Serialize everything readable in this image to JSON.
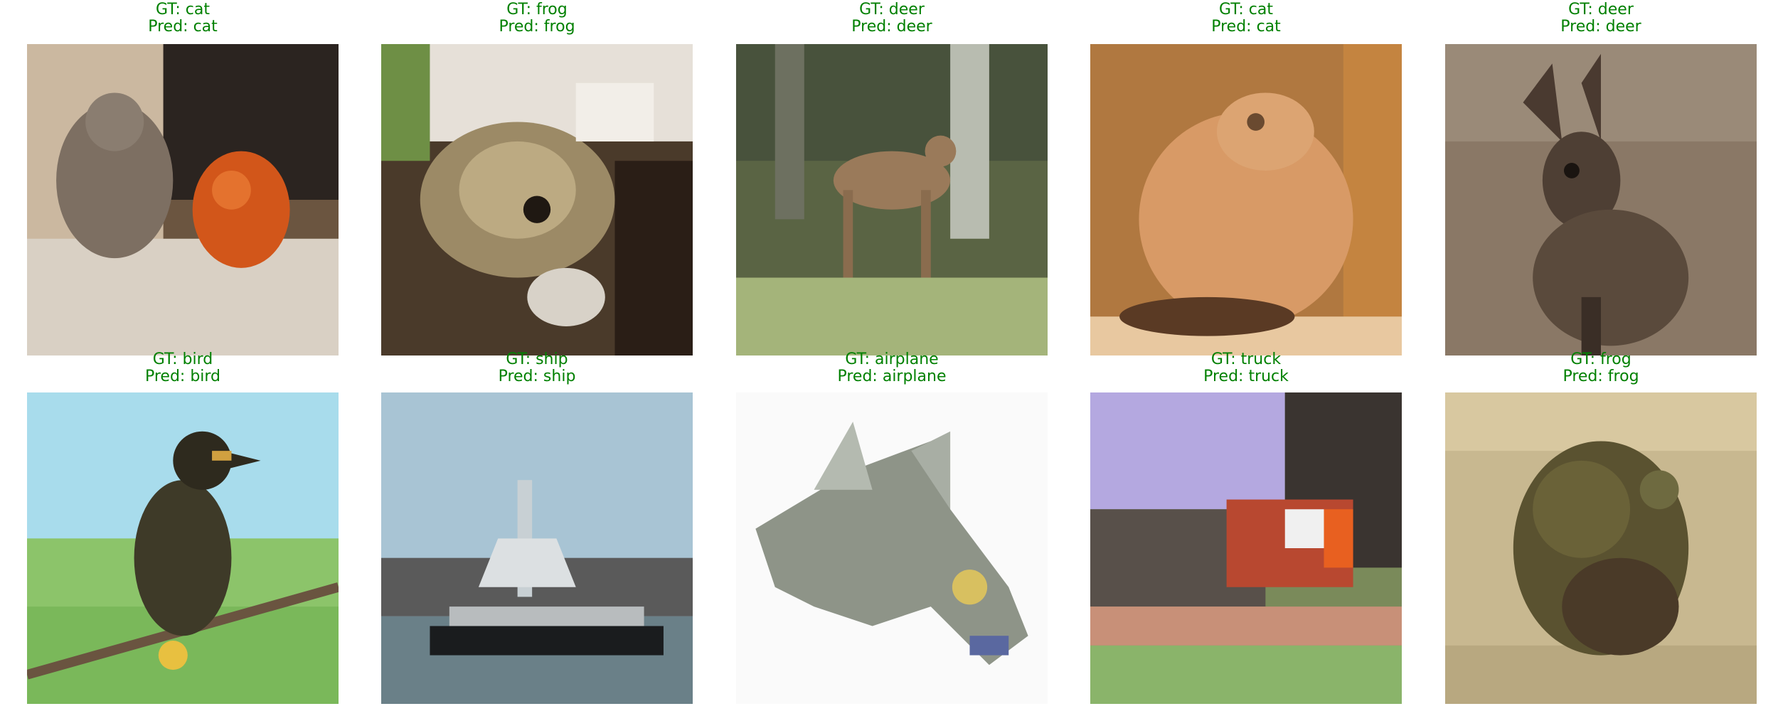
{
  "label_color": "#008000",
  "samples": [
    {
      "gt": "GT: cat",
      "pred": "Pred: cat",
      "subject": "cat-with-orange-pumpkin"
    },
    {
      "gt": "GT: frog",
      "pred": "Pred: frog",
      "subject": "frog-closeup"
    },
    {
      "gt": "GT: deer",
      "pred": "Pred: deer",
      "subject": "deer-in-forest"
    },
    {
      "gt": "GT: cat",
      "pred": "Pred: cat",
      "subject": "orange-cat"
    },
    {
      "gt": "GT: deer",
      "pred": "Pred: deer",
      "subject": "deer-head"
    },
    {
      "gt": "GT: bird",
      "pred": "Pred: bird",
      "subject": "bird-on-branch"
    },
    {
      "gt": "GT: ship",
      "pred": "Pred: ship",
      "subject": "ship-on-water"
    },
    {
      "gt": "GT: airplane",
      "pred": "Pred: airplane",
      "subject": "jet-airplane"
    },
    {
      "gt": "GT: truck",
      "pred": "Pred: truck",
      "subject": "truck-near-building"
    },
    {
      "gt": "GT: frog",
      "pred": "Pred: frog",
      "subject": "frog-on-sand"
    }
  ]
}
